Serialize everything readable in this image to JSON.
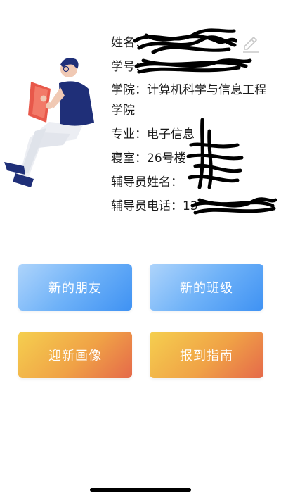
{
  "profile": {
    "name_label": "姓名：",
    "student_id_label": "学号：",
    "college_label": "学院：",
    "college_value": "计算机科学与信息工程学院",
    "major_label": "专业：",
    "major_value": "电子信息",
    "dorm_label": "寝室：",
    "dorm_value": "26号楼",
    "counselor_name_label": "辅导员姓名：",
    "counselor_phone_label": "辅导员电话：",
    "counselor_phone_value": "13"
  },
  "icons": {
    "edit": "pencil-edit-icon",
    "illustration": "person-reading-book-illustration"
  },
  "buttons": {
    "new_friends": "新的朋友",
    "new_class": "新的班级",
    "welcome_portrait": "迎新画像",
    "registration_guide": "报到指南"
  },
  "colors": {
    "blue_start": "#aed4fb",
    "blue_end": "#3f92f3",
    "orange_start": "#f5cf4f",
    "orange_end": "#e5694a",
    "illustration_navy": "#1f2f78",
    "illustration_red": "#e8584a"
  }
}
